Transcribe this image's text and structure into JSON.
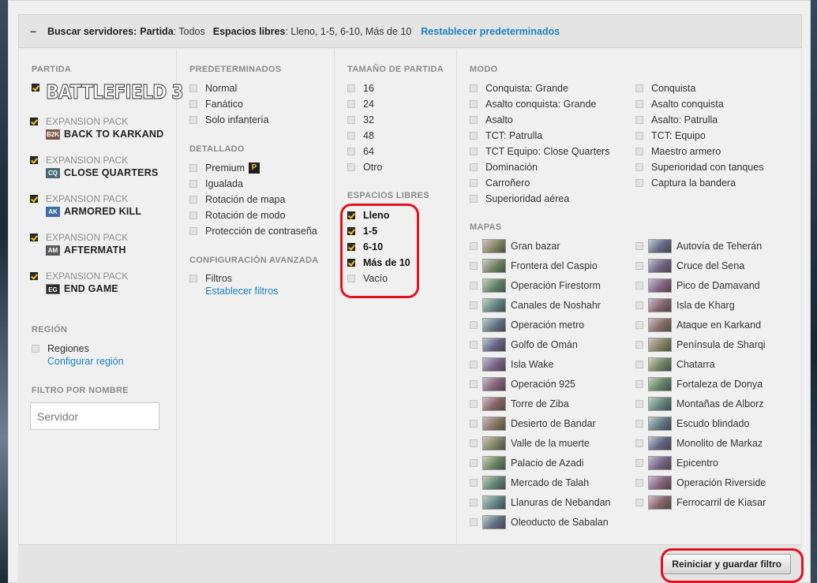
{
  "header": {
    "collapse_symbol": "−",
    "search_label": "Buscar servidores:",
    "partida_label": "Partida",
    "partida_value": ": Todos",
    "espacios_label": "Espacios libres",
    "espacios_value": ": Lleno, 1-5, 6-10, Más de 10",
    "reset_link": "Restablecer predeterminados"
  },
  "partida": {
    "title": "PARTIDA",
    "logo_text": "BATTLEFIELD 3",
    "base_checked": true,
    "expansions": [
      {
        "pack": "EXPANSION PACK",
        "tag": "B2K",
        "name": "BACK TO KARKAND",
        "checked": true,
        "tag_color": "#7c5a4a"
      },
      {
        "pack": "EXPANSION PACK",
        "tag": "CQ",
        "name": "CLOSE QUARTERS",
        "checked": true,
        "tag_color": "#4a6a7a"
      },
      {
        "pack": "EXPANSION PACK",
        "tag": "AK",
        "name": "ARMORED KILL",
        "checked": true,
        "tag_color": "#3a6ea5"
      },
      {
        "pack": "EXPANSION PACK",
        "tag": "AM",
        "name": "AFTERMATH",
        "checked": true,
        "tag_color": "#5a5a5a"
      },
      {
        "pack": "EXPANSION PACK",
        "tag": "EG",
        "name": "END GAME",
        "checked": true,
        "tag_color": "#2b2b2b"
      }
    ]
  },
  "region": {
    "title": "REGIÓN",
    "option": "Regiones",
    "link": "Configurar región"
  },
  "name_filter": {
    "title": "FILTRO POR NOMBRE",
    "placeholder": "Servidor"
  },
  "presets": {
    "title": "PREDETERMINADOS",
    "options": [
      "Normal",
      "Fanático",
      "Solo infantería"
    ]
  },
  "detail": {
    "title": "DETALLADO",
    "options": [
      "Premium",
      "Igualada",
      "Rotación de mapa",
      "Rotación de modo",
      "Protección de contraseña"
    ],
    "premium_icon": "P"
  },
  "advanced": {
    "title": "CONFIGURACIÓN AVANZADA",
    "option": "Filtros",
    "link": "Establecer filtros"
  },
  "size": {
    "title": "TAMAÑO DE PARTIDA",
    "options": [
      "16",
      "24",
      "32",
      "48",
      "64",
      "Otro"
    ]
  },
  "slots": {
    "title": "ESPACIOS LIBRES",
    "options": [
      {
        "label": "Lleno",
        "checked": true
      },
      {
        "label": "1-5",
        "checked": true
      },
      {
        "label": "6-10",
        "checked": true
      },
      {
        "label": "Más de 10",
        "checked": true
      },
      {
        "label": "Vacío",
        "checked": false
      }
    ]
  },
  "modes": {
    "title": "MODO",
    "left": [
      "Conquista: Grande",
      "Asalto conquista: Grande",
      "Asalto",
      "TCT: Patrulla",
      "TCT Equipo: Close Quarters",
      "Dominación",
      "Carroñero",
      "Superioridad aérea"
    ],
    "right": [
      "Conquista",
      "Asalto conquista",
      "Asalto: Patrulla",
      "TCT: Equipo",
      "Maestro armero",
      "Superioridad con tanques",
      "Captura la bandera"
    ]
  },
  "maps": {
    "title": "MAPAS",
    "left": [
      "Gran bazar",
      "Frontera del Caspio",
      "Operación Firestorm",
      "Canales de Noshahr",
      "Operación metro",
      "Golfo de Omán",
      "Isla Wake",
      "Operación 925",
      "Torre de Ziba",
      "Desierto de Bandar",
      "Valle de la muerte",
      "Palacio de Azadi",
      "Mercado de Talah",
      "Llanuras de Nebandan",
      "Oleoducto de Sabalan"
    ],
    "right": [
      "Autovía de Teherán",
      "Cruce del Sena",
      "Pico de Damavand",
      "Isla de Kharg",
      "Ataque en Karkand",
      "Península de Sharqi",
      "Chatarra",
      "Fortaleza de Donya",
      "Montañas de Alborz",
      "Escudo blindado",
      "Monolito de Markaz",
      "Epicentro",
      "Operación Riverside",
      "Ferrocarril de Kiasar"
    ]
  },
  "footer": {
    "save_button": "Reiniciar y guardar filtro"
  },
  "colors": {
    "accent_link": "#1a82c6",
    "checkbox_check": "#f2c019",
    "highlight_ring": "#e3101e"
  }
}
